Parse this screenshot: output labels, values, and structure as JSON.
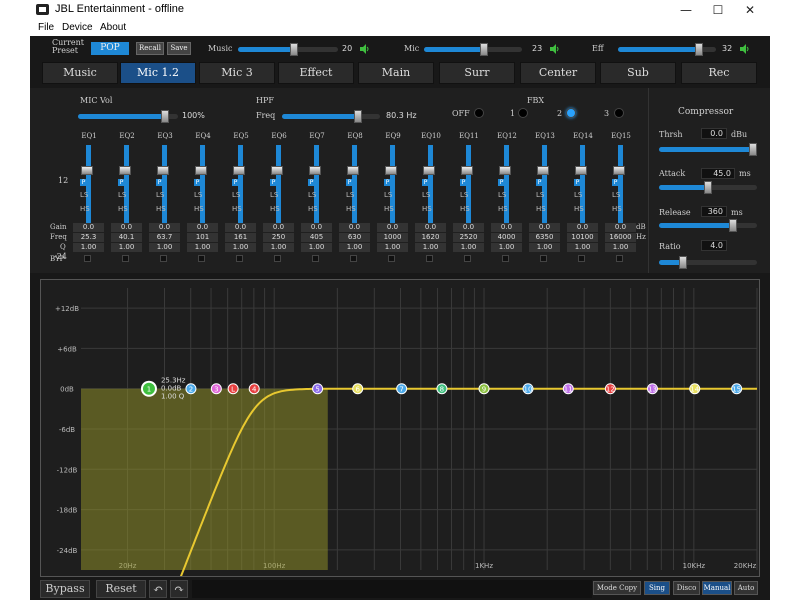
{
  "window": {
    "title": "JBL Entertainment - offline",
    "min": "—",
    "max": "☐",
    "close": "✕"
  },
  "menu": {
    "file": "File",
    "device": "Device",
    "about": "About"
  },
  "topbar": {
    "current_preset_label": "Current\nPreset",
    "preset_value": "POP",
    "recall": "Recall",
    "save": "Save",
    "music_label": "Music",
    "music_value": "20",
    "music_level": 0.56,
    "mic_label": "Mic",
    "mic_value": "23",
    "mic_level": 0.62,
    "eff_label": "Eff",
    "eff_value": "32",
    "eff_level": 0.86
  },
  "tabs": [
    "Music",
    "Mic 1.2",
    "Mic 3",
    "Effect",
    "Main",
    "Surr",
    "Center",
    "Sub",
    "Rec"
  ],
  "active_tab": 1,
  "panel": {
    "mic_vol_label": "MIC Vol",
    "mic_vol_value": "100%",
    "mic_vol_level": 0.9,
    "hpf_label": "HPF",
    "freq_label": "Freq",
    "hpf_value": "80.3 Hz",
    "fbx_label": "FBX",
    "fbx_off": "OFF",
    "fbx_1": "1",
    "fbx_2": "2",
    "fbx_3": "3",
    "scale_top": "12",
    "scale_bottom": "-24",
    "row_gain": "Gain",
    "row_freq": "Freq",
    "row_q": "Q",
    "row_byp": "BYP",
    "unit_db": "dB",
    "unit_hz": "Hz",
    "bands": [
      {
        "name": "EQ1",
        "gain": "0.0",
        "freq": "25.3",
        "q": "1.00",
        "p": "P",
        "ls": "LS",
        "hs": "HS"
      },
      {
        "name": "EQ2",
        "gain": "0.0",
        "freq": "40.1",
        "q": "1.00",
        "p": "P",
        "ls": "LS",
        "hs": "HS"
      },
      {
        "name": "EQ3",
        "gain": "0.0",
        "freq": "63.7",
        "q": "1.00",
        "p": "P",
        "ls": "LS",
        "hs": "HS"
      },
      {
        "name": "EQ4",
        "gain": "0.0",
        "freq": "101",
        "q": "1.00",
        "p": "P",
        "ls": "LS",
        "hs": "HS"
      },
      {
        "name": "EQ5",
        "gain": "0.0",
        "freq": "161",
        "q": "1.00",
        "p": "P",
        "ls": "LS",
        "hs": "HS"
      },
      {
        "name": "EQ6",
        "gain": "0.0",
        "freq": "250",
        "q": "1.00",
        "p": "P",
        "ls": "LS",
        "hs": "HS"
      },
      {
        "name": "EQ7",
        "gain": "0.0",
        "freq": "405",
        "q": "1.00",
        "p": "P",
        "ls": "LS",
        "hs": "HS"
      },
      {
        "name": "EQ8",
        "gain": "0.0",
        "freq": "630",
        "q": "1.00",
        "p": "P",
        "ls": "LS",
        "hs": "HS"
      },
      {
        "name": "EQ9",
        "gain": "0.0",
        "freq": "1000",
        "q": "1.00",
        "p": "P",
        "ls": "LS",
        "hs": "HS"
      },
      {
        "name": "EQ10",
        "gain": "0.0",
        "freq": "1620",
        "q": "1.00",
        "p": "P",
        "ls": "LS",
        "hs": "HS"
      },
      {
        "name": "EQ11",
        "gain": "0.0",
        "freq": "2520",
        "q": "1.00",
        "p": "P",
        "ls": "LS",
        "hs": "HS"
      },
      {
        "name": "EQ12",
        "gain": "0.0",
        "freq": "4000",
        "q": "1.00",
        "p": "P",
        "ls": "LS",
        "hs": "HS"
      },
      {
        "name": "EQ13",
        "gain": "0.0",
        "freq": "6350",
        "q": "1.00",
        "p": "P",
        "ls": "LS",
        "hs": "HS"
      },
      {
        "name": "EQ14",
        "gain": "0.0",
        "freq": "10100",
        "q": "1.00",
        "p": "P",
        "ls": "LS",
        "hs": "HS"
      },
      {
        "name": "EQ15",
        "gain": "0.0",
        "freq": "16000",
        "q": "1.00",
        "p": "P",
        "ls": "LS",
        "hs": "HS"
      }
    ]
  },
  "compressor": {
    "title": "Compressor",
    "thrsh_label": "Thrsh",
    "thrsh_value": "0.0",
    "thrsh_unit": "dBu",
    "thrsh_level": 1.0,
    "attack_label": "Attack",
    "attack_value": "45.0",
    "attack_unit": "ms",
    "attack_level": 0.5,
    "release_label": "Release",
    "release_value": "360",
    "release_unit": "ms",
    "release_level": 0.78,
    "ratio_label": "Ratio",
    "ratio_value": "4.0",
    "ratio_level": 0.22
  },
  "graph": {
    "y_labels": [
      "+12dB",
      "+6dB",
      "0dB",
      "-6dB",
      "-12dB",
      "-18dB",
      "-24dB"
    ],
    "x_labels": [
      "20Hz",
      "100Hz",
      "1KHz",
      "10KHz",
      "20KHz"
    ],
    "selected_info": [
      "25.3Hz",
      "0.0dB",
      "1.00 Q"
    ],
    "node_labels": [
      "1",
      "2",
      "3",
      "L",
      "4",
      "5",
      "6",
      "7",
      "8",
      "9",
      "10",
      "11",
      "12",
      "13",
      "14",
      "15"
    ],
    "node_colors": [
      "#3fbf3f",
      "#4aa8e8",
      "#e066d8",
      "#e84040",
      "#e84040",
      "#8a6ae8",
      "#e8e060",
      "#4aa8e8",
      "#3fbf7f",
      "#8abf3f",
      "#4aa8e8",
      "#c070e8",
      "#e84040",
      "#c070e8",
      "#e8e060",
      "#4aa8e8"
    ],
    "curve_color": "#e8c830"
  },
  "bottom": {
    "bypass": "Bypass",
    "reset": "Reset",
    "undo": "↶",
    "redo": "↷",
    "mode_copy": "Mode Copy",
    "sing": "Sing",
    "disco": "Disco",
    "manual": "Manual",
    "auto": "Auto"
  }
}
